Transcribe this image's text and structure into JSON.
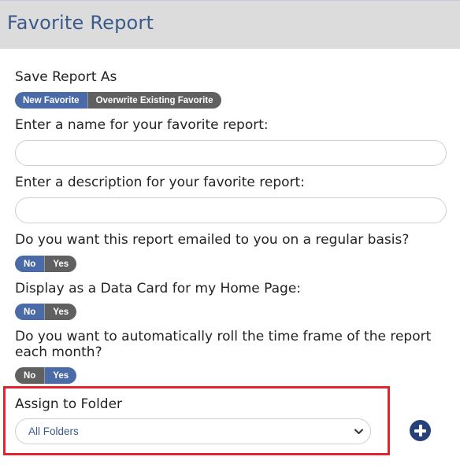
{
  "header": {
    "title": "Favorite Report"
  },
  "save_as": {
    "label": "Save Report As",
    "options": [
      "New Favorite",
      "Overwrite Existing Favorite"
    ],
    "selected": "New Favorite"
  },
  "name_field": {
    "label": "Enter a name for your favorite report:",
    "value": "",
    "placeholder": ""
  },
  "description_field": {
    "label": "Enter a description for your favorite report:",
    "value": "",
    "placeholder": ""
  },
  "email_question": {
    "label": "Do you want this report emailed to you on a regular basis?",
    "no": "No",
    "yes": "Yes",
    "selected": "No"
  },
  "data_card_question": {
    "label": "Display as a Data Card for my Home Page:",
    "no": "No",
    "yes": "Yes",
    "selected": "No"
  },
  "roll_question": {
    "label": "Do you want to automatically roll the time frame of the report each month?",
    "no": "No",
    "yes": "Yes",
    "selected": "Yes"
  },
  "folder": {
    "label": "Assign to Folder",
    "selected": "All Folders",
    "add_icon": "plus-circle-icon"
  },
  "colors": {
    "accent": "#4a6ba8",
    "inactive": "#606060",
    "header_bg": "#dcdcdc",
    "highlight": "#e52330",
    "add_button": "#28407a"
  }
}
